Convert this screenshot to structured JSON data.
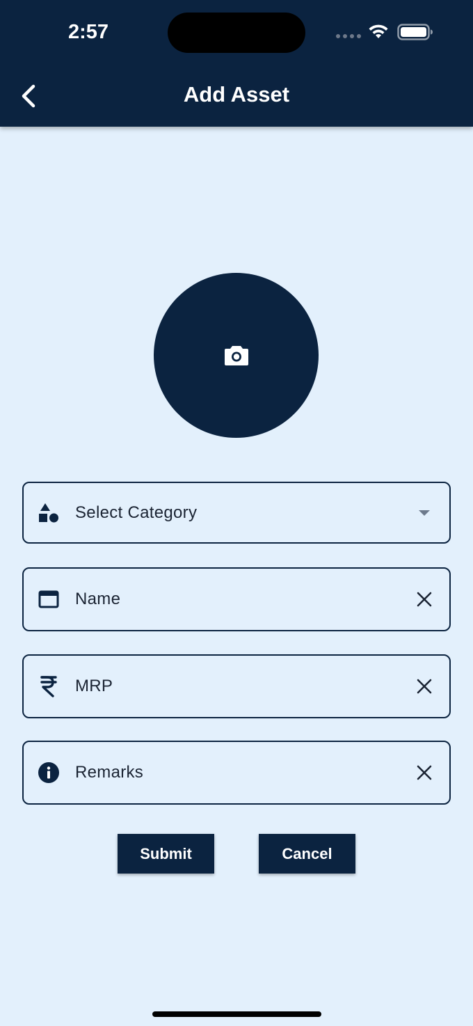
{
  "status_bar": {
    "time": "2:57"
  },
  "header": {
    "title": "Add Asset"
  },
  "form": {
    "category": {
      "placeholder": "Select Category",
      "icon": "category-shapes-icon"
    },
    "name": {
      "placeholder": "Name",
      "icon": "web-asset-icon"
    },
    "mrp": {
      "placeholder": "MRP",
      "icon": "rupee-icon"
    },
    "remarks": {
      "placeholder": "Remarks",
      "icon": "info-icon"
    }
  },
  "actions": {
    "submit_label": "Submit",
    "cancel_label": "Cancel"
  },
  "colors": {
    "primary": "#0b2340",
    "background": "#e3f0fc",
    "on_primary": "#ffffff"
  }
}
